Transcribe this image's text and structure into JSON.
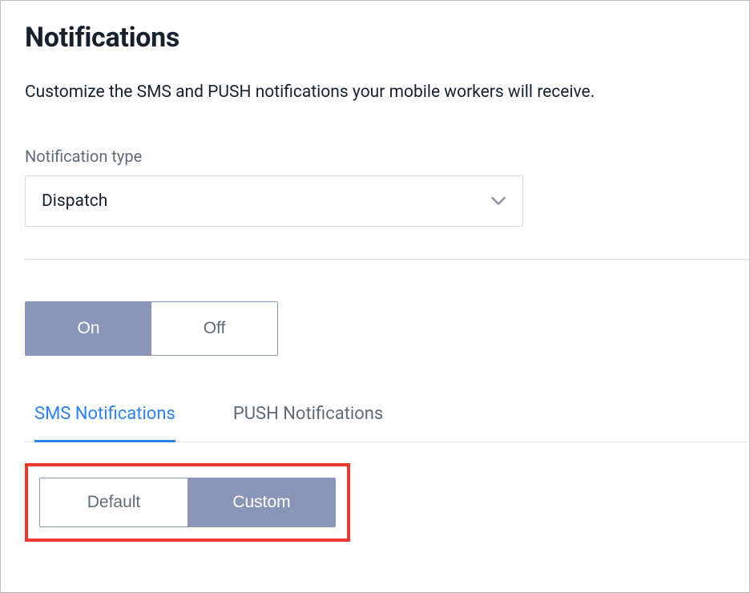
{
  "title": "Notifications",
  "description": "Customize the SMS and PUSH notifications your mobile workers will receive.",
  "notificationType": {
    "label": "Notification type",
    "selected": "Dispatch"
  },
  "toggle": {
    "on": "On",
    "off": "Off"
  },
  "tabs": {
    "sms": "SMS Notifications",
    "push": "PUSH Notifications"
  },
  "mode": {
    "default": "Default",
    "custom": "Custom"
  }
}
